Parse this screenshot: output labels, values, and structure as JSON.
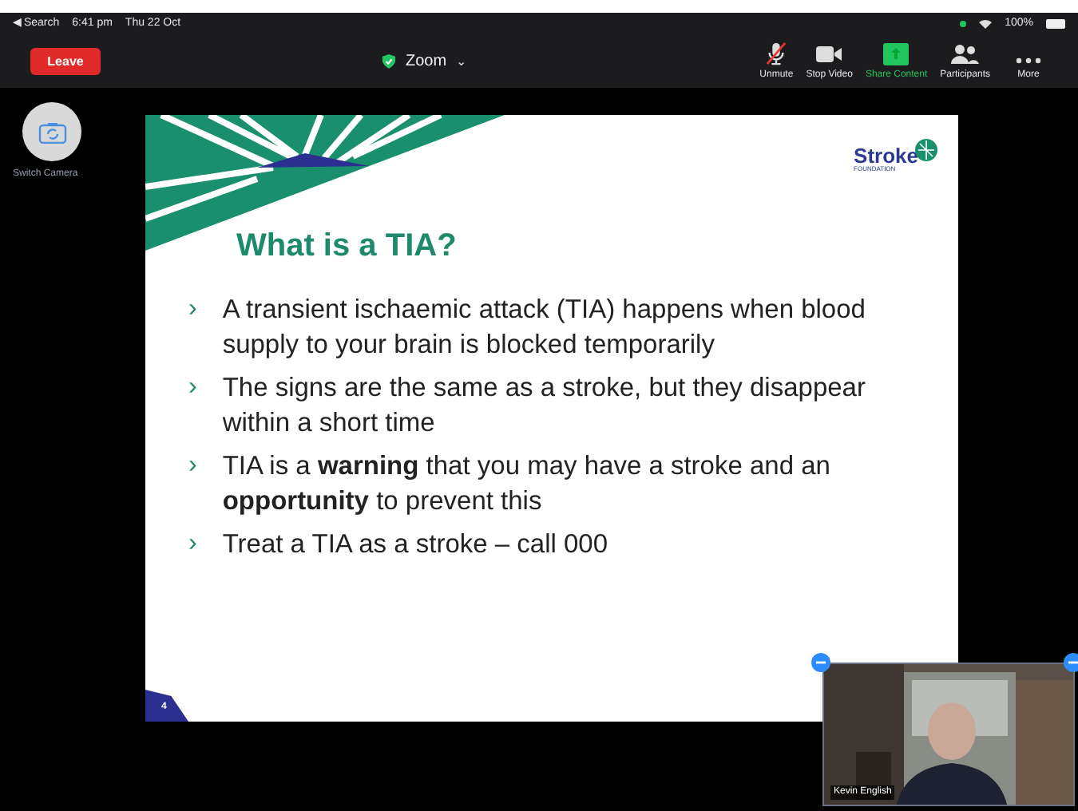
{
  "status_bar": {
    "back": "◀ Search",
    "time": "6:41 pm",
    "date": "Thu 22 Oct",
    "battery": "100%"
  },
  "toolbar": {
    "leave": "Leave",
    "title": "Zoom",
    "secure": true,
    "caret": "⌄",
    "items": [
      {
        "kind": "mic",
        "label": "Unmute",
        "active": false
      },
      {
        "kind": "video",
        "label": "Stop Video",
        "active": false
      },
      {
        "kind": "share",
        "label": "Share Content",
        "active": true
      },
      {
        "kind": "participants",
        "label": "Participants",
        "active": false
      },
      {
        "kind": "more",
        "label": "More",
        "active": false
      }
    ]
  },
  "switch_camera": {
    "label": "Switch Camera"
  },
  "slide": {
    "logo": "Stroke",
    "logo_sub": "FOUNDATION",
    "title": "What is a TIA?",
    "bullet": "›",
    "bullets": [
      "A transient ischaemic attack (TIA) happens when blood supply to your brain is blocked temporarily",
      "The signs are the same as a stroke, but they disappear within a short time",
      "TIA is a **warning** that you may have a stroke and an **opportunity** to prevent this",
      "Treat a TIA as a stroke – call 000"
    ],
    "page": "4"
  },
  "video": {
    "name": "Kevin English"
  }
}
